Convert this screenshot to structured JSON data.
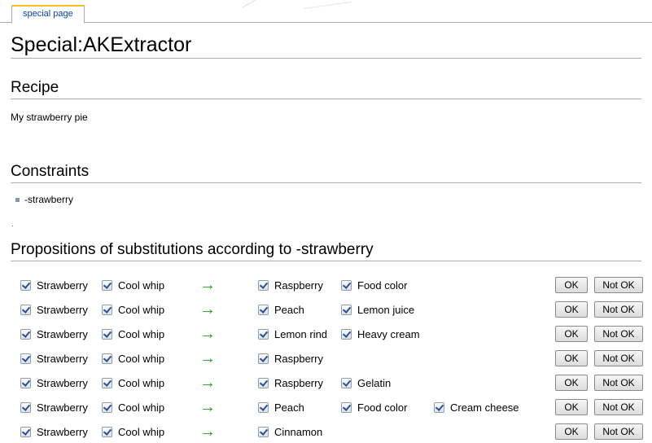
{
  "tab": {
    "label": "special page"
  },
  "page_title": "Special:AKExtractor",
  "recipe": {
    "heading": "Recipe",
    "name": "My strawberry pie"
  },
  "constraints": {
    "heading": "Constraints",
    "items": [
      "-strawberry"
    ],
    "trailing_mark": "."
  },
  "propositions": {
    "heading": "Propositions of substitutions according to -strawberry",
    "arrow_color": "#22a022",
    "ok_label": "OK",
    "not_ok_label": "Not OK",
    "rows": [
      {
        "from": [
          "Strawberry",
          "Cool whip"
        ],
        "to": [
          "Raspberry",
          "Food color"
        ]
      },
      {
        "from": [
          "Strawberry",
          "Cool whip"
        ],
        "to": [
          "Peach",
          "Lemon juice"
        ]
      },
      {
        "from": [
          "Strawberry",
          "Cool whip"
        ],
        "to": [
          "Lemon rind",
          "Heavy cream"
        ]
      },
      {
        "from": [
          "Strawberry",
          "Cool whip"
        ],
        "to": [
          "Raspberry"
        ]
      },
      {
        "from": [
          "Strawberry",
          "Cool whip"
        ],
        "to": [
          "Raspberry",
          "Gelatin"
        ]
      },
      {
        "from": [
          "Strawberry",
          "Cool whip"
        ],
        "to": [
          "Peach",
          "Food color",
          "Cream cheese"
        ]
      },
      {
        "from": [
          "Strawberry",
          "Cool whip"
        ],
        "to": [
          "Cinnamon"
        ]
      }
    ]
  }
}
